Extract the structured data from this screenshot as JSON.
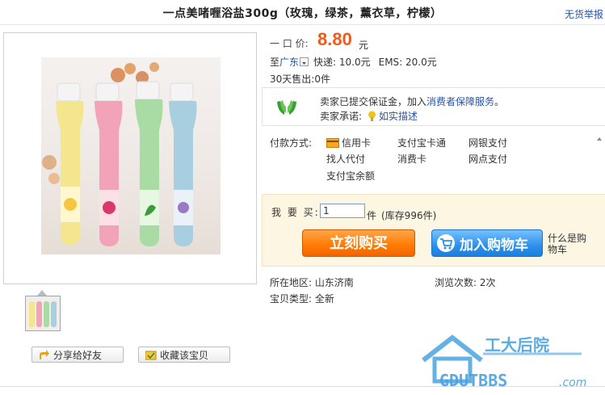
{
  "title": "一点美啫喱浴盐300g（玫瑰，绿茶，薰衣草，柠檬）",
  "report_link": "无货举报",
  "price": {
    "label": "一 口 价:",
    "value": "8.80",
    "unit": "元"
  },
  "shipping": {
    "prefix": "至",
    "location": "广东",
    "express": "快递: 10.0元",
    "ems": "EMS: 20.0元"
  },
  "sold": {
    "label": "30天售出:",
    "value": "0件"
  },
  "guarantee": {
    "line1_text": "卖家已提交保证金，加入",
    "line1_link": "消费者保障服务",
    "line1_end": "。",
    "line2_label": "卖家承诺:",
    "line2_link": "如实描述"
  },
  "payment": {
    "label": "付款方式:",
    "methods": [
      "信用卡",
      "支付宝卡通",
      "网银支付",
      "找人代付",
      "消费卡",
      "网点支付",
      "支付宝余额"
    ]
  },
  "buy": {
    "qty_label": "我 要 买:",
    "qty_value": "1",
    "qty_unit": "件",
    "stock": "(库存996件)",
    "buy_now": "立刻购买",
    "add_cart": "加入购物车",
    "cart_hint": "什么是购物车"
  },
  "details": {
    "region_label": "所在地区:",
    "region_value": "山东济南",
    "views_label": "浏览次数:",
    "views_value": "2次",
    "type_label": "宝贝类型:",
    "type_value": "全新"
  },
  "actions": {
    "share": "分享给好友",
    "favorite": "收藏该宝贝"
  },
  "watermark": {
    "cn": "工大后院",
    "en": "GDUTBBS",
    "suffix": ".com"
  },
  "colors": {
    "price": "#f05a18",
    "link": "#2953a6",
    "buy": "#ff7a00",
    "cart": "#2d91ea"
  }
}
